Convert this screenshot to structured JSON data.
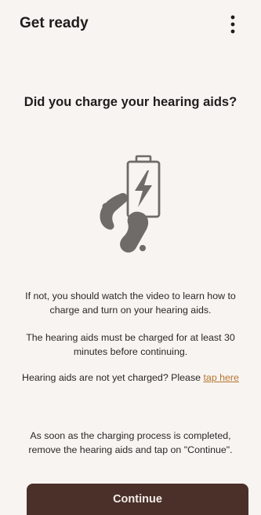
{
  "header": {
    "title": "Get ready",
    "menu_icon": "more-vertical-icon"
  },
  "main": {
    "question": "Did you charge your hearing aids?",
    "illustration_icon": "hearing-aids-charging-icon",
    "paragraph_1": "If not, you should watch the video to learn how to charge and turn on your hearing aids.",
    "paragraph_2": "The hearing aids must be charged for at least 30 minutes before continuing.",
    "paragraph_3_prefix": "Hearing aids are not yet charged? Please ",
    "paragraph_3_link": "tap here",
    "paragraph_4": "As soon as the charging process is completed, remove the hearing aids and tap on \"Continue\"."
  },
  "footer": {
    "continue_label": "Continue"
  },
  "colors": {
    "background": "#f8f4f1",
    "button": "#4b302a",
    "link": "#b4762f",
    "illustration": "#6f6b68"
  }
}
